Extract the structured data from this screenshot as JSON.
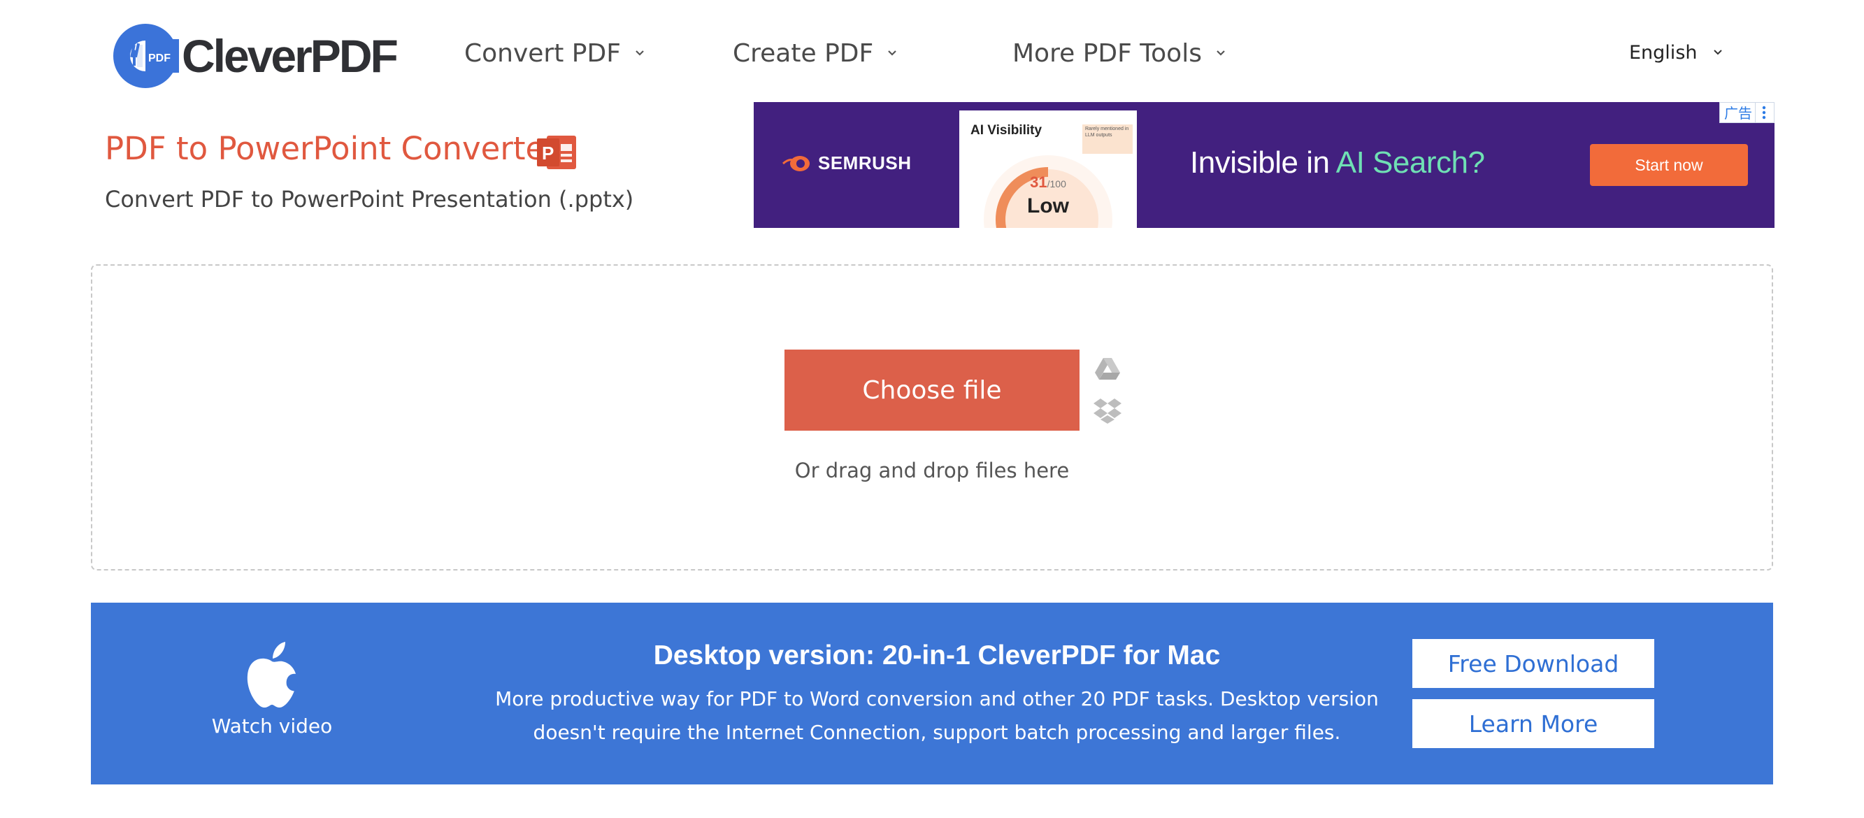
{
  "header": {
    "logo_text": "CleverPDF",
    "logo_badge": "PDF",
    "nav": [
      {
        "label": "Convert PDF"
      },
      {
        "label": "Create PDF"
      },
      {
        "label": "More PDF Tools"
      }
    ],
    "language": "English"
  },
  "page": {
    "title": "PDF to PowerPoint Converter",
    "subtitle": "Convert PDF to PowerPoint Presentation (.pptx)"
  },
  "ad": {
    "brand": "SEMRUSH",
    "card_title": "AI Visibility",
    "card_note": "Rarely mentioned in LLM outputs",
    "score": "31",
    "score_max": "/100",
    "score_level": "Low",
    "headline_prefix": "Invisible in ",
    "headline_highlight": "AI Search?",
    "cta": "Start now",
    "badge": "广告",
    "colors": {
      "background": "#42207f",
      "cta": "#f26b3a",
      "highlight": "#6fe0b4"
    }
  },
  "upload": {
    "choose_file": "Choose file",
    "drag_hint": "Or drag and drop files here",
    "sources": [
      "google-drive-icon",
      "dropbox-icon"
    ]
  },
  "desktop_banner": {
    "watch_video": "Watch video",
    "title": "Desktop version: 20-in-1 CleverPDF for Mac",
    "description": "More productive way for PDF to Word conversion and other 20 PDF tasks. Desktop version doesn't require the Internet Connection, support batch processing and larger files.",
    "free_download": "Free Download",
    "learn_more": "Learn More"
  },
  "colors": {
    "accent": "#dc604a",
    "title": "#e0583f",
    "banner": "#3d76d6",
    "logo_blue": "#3b73d9"
  }
}
